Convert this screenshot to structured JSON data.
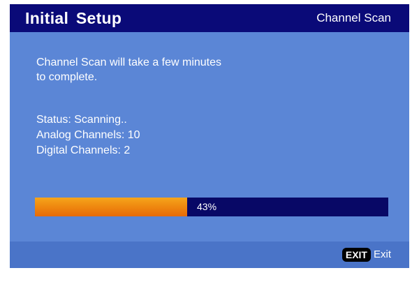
{
  "header": {
    "title": "Initial  Setup",
    "subtitle": "Channel Scan"
  },
  "message": {
    "line1": "Channel Scan will take a few minutes",
    "line2": "to complete."
  },
  "scan": {
    "status": "Status: Scanning..",
    "analog_channels": "Analog Channels: 10",
    "digital_channels": "Digital Channels: 2"
  },
  "progress": {
    "percent": 43,
    "label": "43%"
  },
  "footer": {
    "exit_key": "EXIT",
    "exit_label": "Exit"
  },
  "colors": {
    "background": "#5b86d6",
    "header_bar": "#0a0a78",
    "footer_bar": "#4a74c8",
    "progress_track": "#080866",
    "progress_fill": "#ef8a10"
  }
}
